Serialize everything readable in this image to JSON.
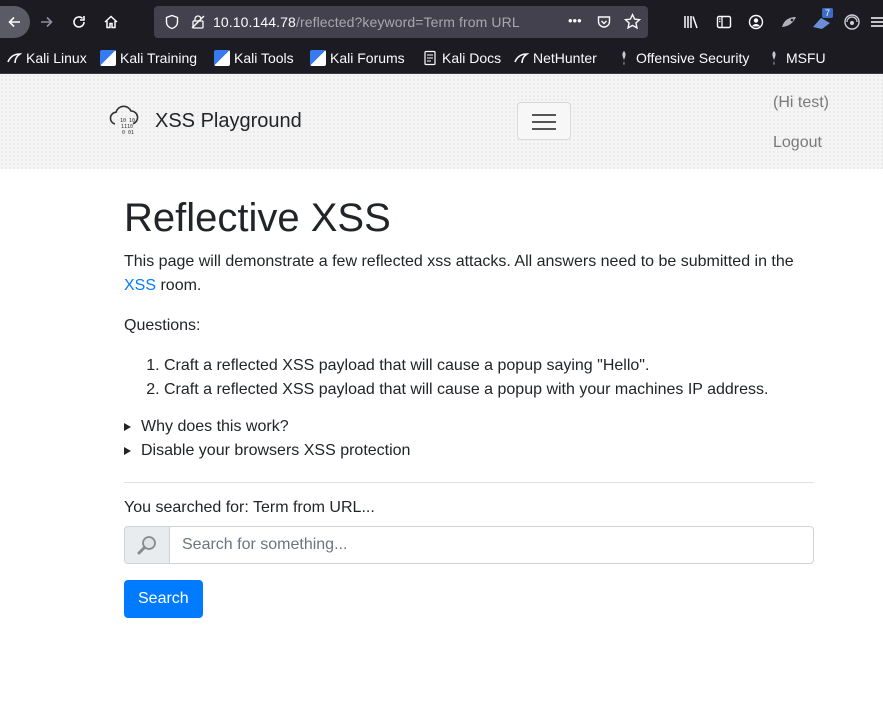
{
  "browser": {
    "url_host": "10.10.144.78",
    "url_path": "/reflected?keyword=Term from URL",
    "more_label": "•••",
    "extension_badge": "7",
    "bookmarks": [
      {
        "label": "Kali Linux",
        "icon": "kali-dragon-icon"
      },
      {
        "label": "Kali Training",
        "icon": "kali-training-icon"
      },
      {
        "label": "Kali Tools",
        "icon": "kali-tools-icon"
      },
      {
        "label": "Kali Forums",
        "icon": "kali-forums-icon"
      },
      {
        "label": "Kali Docs",
        "icon": "kali-docs-icon"
      },
      {
        "label": "NetHunter",
        "icon": "nethunter-icon"
      },
      {
        "label": "Offensive Security",
        "icon": "offsec-icon"
      },
      {
        "label": "MSFU",
        "icon": "msfu-icon"
      }
    ]
  },
  "navbar": {
    "brand": "XSS Playground",
    "user": "(Hi test)",
    "logout": "Logout"
  },
  "main": {
    "title": "Reflective XSS",
    "intro_text": "This page will demonstrate a few reflected xss attacks. All answers need to be submitted in the",
    "intro_link": "XSS",
    "intro_suffix": "room.",
    "questions_label": "Questions:",
    "questions": [
      "Craft a reflected XSS payload that will cause a popup saying \"Hello\".",
      "Craft a reflected XSS payload that will cause a popup with your machines IP address."
    ],
    "details": [
      "Why does this work?",
      "Disable your browsers XSS protection"
    ],
    "searched_text": "You searched for: Term from URL...",
    "search_placeholder": "Search for something...",
    "search_button": "Search"
  },
  "colors": {
    "accent": "#007bff",
    "browser_chrome": "#1c1b22"
  }
}
